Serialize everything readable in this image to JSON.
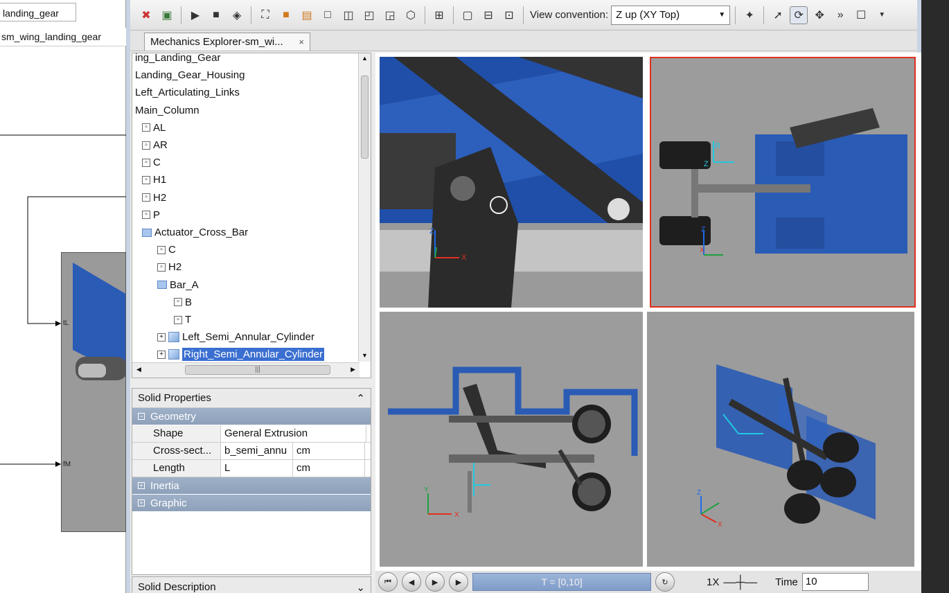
{
  "simulink": {
    "breadcrumb_tab": "landing_gear",
    "breadcrumb_path": "sm_wing_landing_gear",
    "port_labels": [
      "tL",
      "fM"
    ]
  },
  "toolbar": {
    "view_convention_label": "View convention:",
    "view_convention_value": "Z up (XY Top)"
  },
  "tab": {
    "title": "Mechanics Explorer-sm_wi..."
  },
  "tree": {
    "items": [
      {
        "label": "ing_Landing_Gear",
        "kind": "none",
        "indent": 0
      },
      {
        "label": "Landing_Gear_Housing",
        "kind": "none",
        "indent": 0
      },
      {
        "label": "Left_Articulating_Links",
        "kind": "none",
        "indent": 0
      },
      {
        "label": "Main_Column",
        "kind": "none",
        "indent": 0
      },
      {
        "label": "AL",
        "kind": "port",
        "indent": 1
      },
      {
        "label": "AR",
        "kind": "port",
        "indent": 1
      },
      {
        "label": "C",
        "kind": "port",
        "indent": 1
      },
      {
        "label": "H1",
        "kind": "port",
        "indent": 1
      },
      {
        "label": "H2",
        "kind": "port",
        "indent": 1
      },
      {
        "label": "P",
        "kind": "port",
        "indent": 1
      },
      {
        "label": "Actuator_Cross_Bar",
        "kind": "frame",
        "indent": 1
      },
      {
        "label": "C",
        "kind": "port",
        "indent": 2
      },
      {
        "label": "H2",
        "kind": "port",
        "indent": 2
      },
      {
        "label": "Bar_A",
        "kind": "frame",
        "indent": 2
      },
      {
        "label": "B",
        "kind": "port",
        "indent": 3
      },
      {
        "label": "T",
        "kind": "port",
        "indent": 3
      },
      {
        "label": "Left_Semi_Annular_Cylinder",
        "kind": "solid",
        "indent": 2
      },
      {
        "label": "Right_Semi_Annular_Cylinder",
        "kind": "solid",
        "indent": 2,
        "selected": true
      }
    ]
  },
  "properties": {
    "title": "Solid Properties",
    "geometry_section": "Geometry",
    "rows": [
      {
        "key": "Shape",
        "value": "General Extrusion",
        "unit": ""
      },
      {
        "key": "Cross-sect...",
        "value": "b_semi_annu",
        "unit": "cm"
      },
      {
        "key": "Length",
        "value": "L",
        "unit": "cm"
      }
    ],
    "inertia_section": "Inertia",
    "graphic_section": "Graphic",
    "description_title": "Solid Description"
  },
  "playback": {
    "time_range": "T = [0,10]",
    "rate": "1X",
    "time_label": "Time",
    "time_value": "10"
  },
  "colors": {
    "accent": "#3a6fd1",
    "viewport_bg": "#9c9c9c",
    "active_border": "#e0301e",
    "part_blue": "#2a5bb5"
  }
}
